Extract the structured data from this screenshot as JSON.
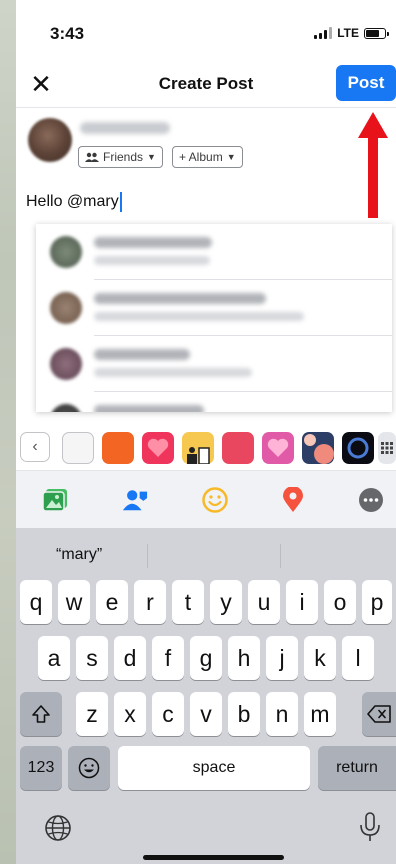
{
  "status_bar": {
    "time": "3:43",
    "network": "LTE"
  },
  "header": {
    "title": "Create Post",
    "post_label": "Post"
  },
  "author": {
    "audience_label": "Friends",
    "album_label": "+ Album"
  },
  "composer": {
    "text": "Hello @mary"
  },
  "keyboard": {
    "suggestion": "“mary”",
    "row1": [
      "q",
      "w",
      "e",
      "r",
      "t",
      "y",
      "u",
      "i",
      "o",
      "p"
    ],
    "row2": [
      "a",
      "s",
      "d",
      "f",
      "g",
      "h",
      "j",
      "k",
      "l"
    ],
    "row3": [
      "z",
      "x",
      "c",
      "v",
      "b",
      "n",
      "m"
    ],
    "numbers_label": "123",
    "space_label": "space",
    "return_label": "return"
  },
  "colors": {
    "accent": "#1877f2",
    "annotation": "#e8121b"
  }
}
